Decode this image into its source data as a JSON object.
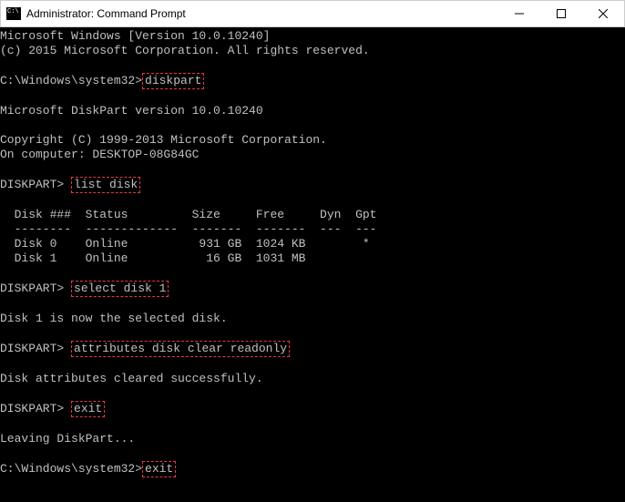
{
  "window": {
    "title": "Administrator: Command Prompt"
  },
  "lines": {
    "l1": "Microsoft Windows [Version 10.0.10240]",
    "l2": "(c) 2015 Microsoft Corporation. All rights reserved.",
    "prompt1": "C:\\Windows\\system32>",
    "cmd1": "diskpart",
    "l4": "Microsoft DiskPart version 10.0.10240",
    "l5": "Copyright (C) 1999-2013 Microsoft Corporation.",
    "l6": "On computer: DESKTOP-08G84GC",
    "prompt2": "DISKPART> ",
    "cmd2": "list disk",
    "tableHeader": "  Disk ###  Status         Size     Free     Dyn  Gpt",
    "tableSep": "  --------  -------------  -------  -------  ---  ---",
    "row0": "  Disk 0    Online          931 GB  1024 KB        *",
    "row1": "  Disk 1    Online           16 GB  1031 MB",
    "prompt3": "DISKPART> ",
    "cmd3": "select disk 1",
    "l11": "Disk 1 is now the selected disk.",
    "prompt4": "DISKPART> ",
    "cmd4": "attributes disk clear readonly",
    "l13": "Disk attributes cleared successfully.",
    "prompt5": "DISKPART> ",
    "cmd5": "exit",
    "l15": "Leaving DiskPart...",
    "prompt6": "C:\\Windows\\system32>",
    "cmd6": "exit"
  }
}
